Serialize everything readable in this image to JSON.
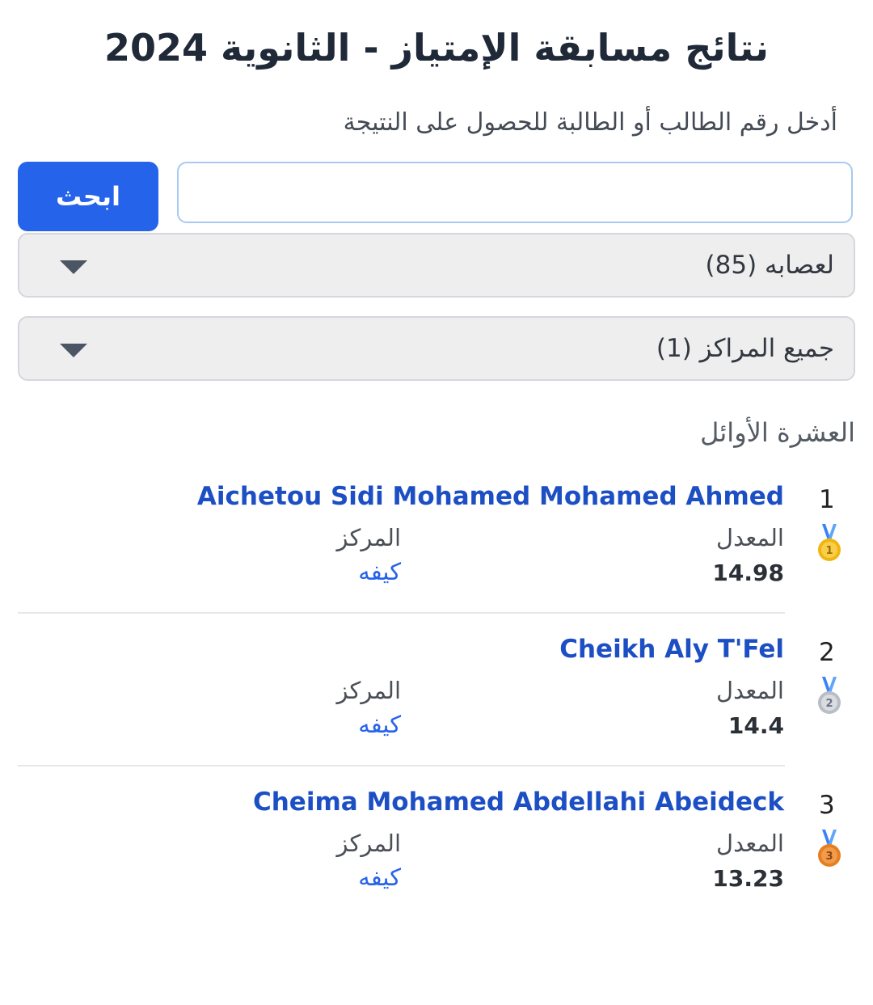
{
  "page": {
    "title": "نتائج مسابقة الإمتياز - الثانوية 2024",
    "instruction": "أدخل رقم الطالب أو الطالبة للحصول على النتيجة"
  },
  "search": {
    "value": "",
    "button_label": "ابحث"
  },
  "filters": {
    "region": {
      "selected": "لعصابه (85)",
      "icon": "caret-down-icon"
    },
    "center": {
      "selected": "جميع المراكز (1)",
      "icon": "caret-down-icon"
    }
  },
  "top_ten": {
    "heading": "العشرة الأوائل",
    "results": [
      {
        "rank": "1",
        "medal": "gold-medal-icon",
        "medal_color": "#f2b50f",
        "name": "Aichetou Sidi Mohamed Mohamed Ahmed",
        "average_label": "المعدل",
        "average": "14.98",
        "center_label": "المركز",
        "center": "كيفه"
      },
      {
        "rank": "2",
        "medal": "silver-medal-icon",
        "medal_color": "#b9bec6",
        "name": "Cheikh Aly T'Fel",
        "average_label": "المعدل",
        "average": "14.4",
        "center_label": "المركز",
        "center": "كيفه"
      },
      {
        "rank": "3",
        "medal": "bronze-medal-icon",
        "medal_color": "#e67e22",
        "name": "Cheima Mohamed Abdellahi Abeideck",
        "average_label": "المعدل",
        "average": "13.23",
        "center_label": "المركز",
        "center": "كيفه"
      }
    ]
  },
  "colors": {
    "accent": "#2563eb",
    "link": "#1d4fc4",
    "select_bg": "#eeeeef"
  }
}
